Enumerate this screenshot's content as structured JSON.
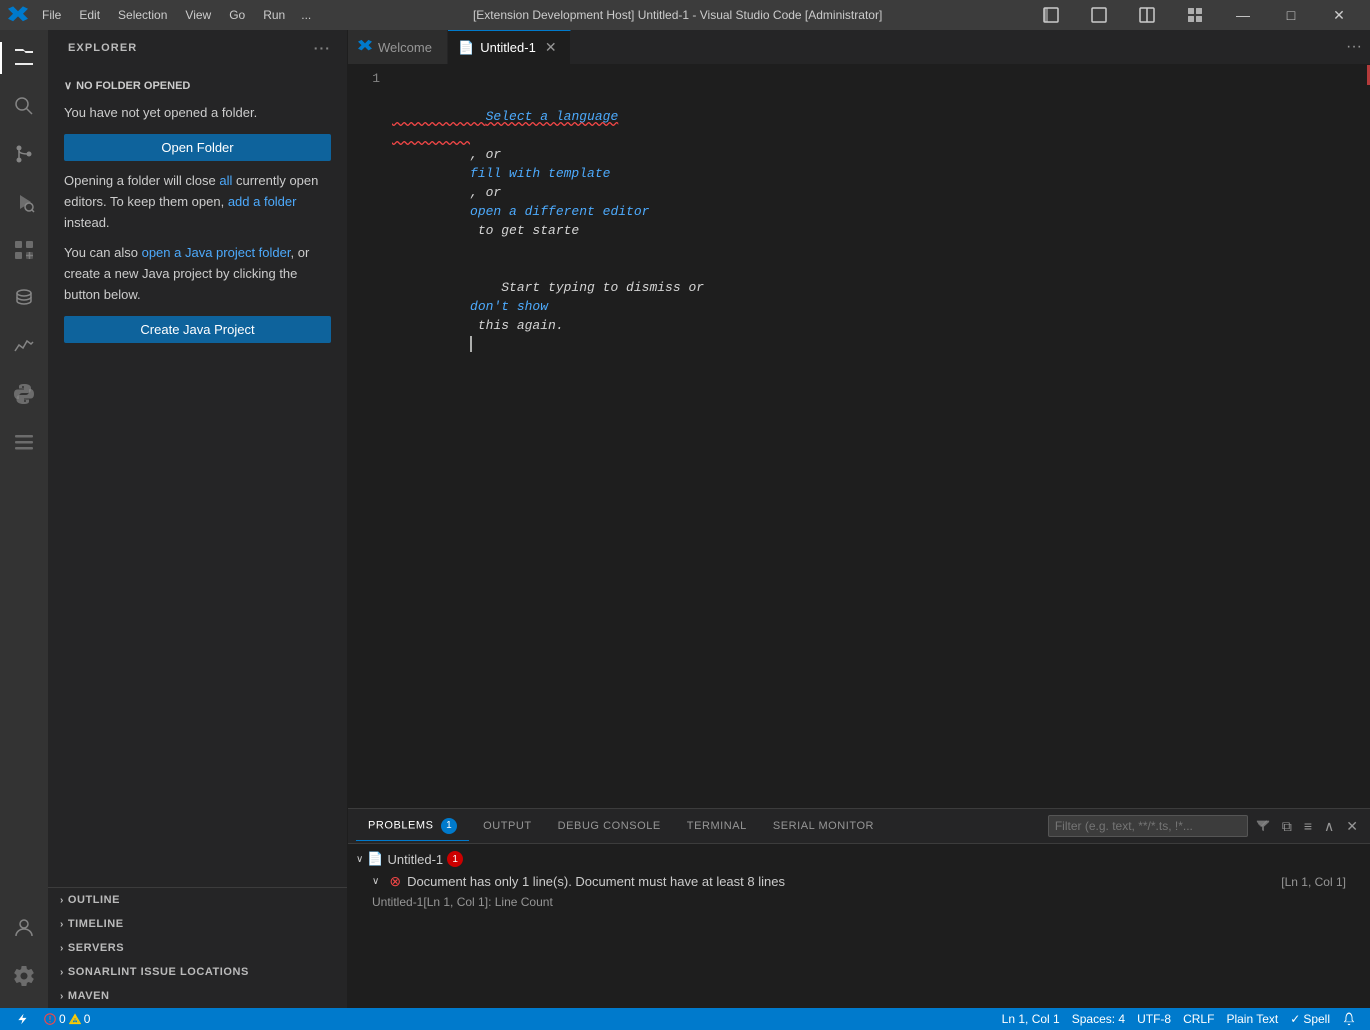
{
  "titlebar": {
    "title": "[Extension Development Host] Untitled-1 - Visual Studio Code [Administrator]",
    "menu": [
      "File",
      "Edit",
      "Selection",
      "View",
      "Go",
      "Run",
      "..."
    ],
    "controls": {
      "minimize": "—",
      "maximize": "□",
      "close": "✕"
    }
  },
  "activity_bar": {
    "items": [
      {
        "id": "explorer",
        "icon": "⎘",
        "label": "Explorer",
        "active": true
      },
      {
        "id": "search",
        "icon": "🔍",
        "label": "Search"
      },
      {
        "id": "source-control",
        "icon": "⑂",
        "label": "Source Control"
      },
      {
        "id": "run",
        "icon": "▷",
        "label": "Run and Debug"
      },
      {
        "id": "extensions",
        "icon": "⊞",
        "label": "Extensions"
      },
      {
        "id": "database",
        "icon": "⊡",
        "label": "Database"
      },
      {
        "id": "monitoring",
        "icon": "📈",
        "label": "Monitoring"
      },
      {
        "id": "python",
        "icon": "🐍",
        "label": "Python"
      },
      {
        "id": "stacks",
        "icon": "≡",
        "label": "Stacks"
      }
    ],
    "bottom": [
      {
        "id": "accounts",
        "icon": "👤",
        "label": "Accounts"
      },
      {
        "id": "settings",
        "icon": "⚙",
        "label": "Settings"
      }
    ]
  },
  "sidebar": {
    "header": "Explorer",
    "no_folder": {
      "title": "No Folder Opened",
      "text1": "You have not yet opened a folder.",
      "open_folder_btn": "Open Folder",
      "text2_prefix": "Opening a folder will close ",
      "text2_link1": "all",
      "text2_mid": " currently open editors. To keep them open, ",
      "text2_link2": "add a folder",
      "text2_suffix": " instead.",
      "text3_prefix": "You can also ",
      "text3_link1": "open a Java project folder",
      "text3_mid": ", or create a new Java project by clicking the button below.",
      "create_java_btn": "Create Java Project"
    },
    "sections": [
      {
        "id": "outline",
        "label": "OUTLINE"
      },
      {
        "id": "timeline",
        "label": "TIMELINE"
      },
      {
        "id": "servers",
        "label": "SERVERS"
      },
      {
        "id": "sonarlint",
        "label": "SONARLINT ISSUE LOCATIONS"
      },
      {
        "id": "maven",
        "label": "MAVEN"
      }
    ]
  },
  "tabs": [
    {
      "id": "welcome",
      "label": "Welcome",
      "icon": "vscode",
      "active": false
    },
    {
      "id": "untitled1",
      "label": "Untitled-1",
      "icon": "file",
      "active": true,
      "modified": true,
      "close": "✕"
    }
  ],
  "editor": {
    "line_numbers": [
      "1"
    ],
    "line1_part1": "Select a language",
    "line1_sep1": ", or ",
    "line1_part2": "fill with template",
    "line1_sep2": ", or ",
    "line1_part3": "open a different editor",
    "line1_sep3": " to get starte",
    "line2_part1": "Start typing to dismiss or ",
    "line2_link": "don't show",
    "line2_suffix": " this again."
  },
  "panel": {
    "tabs": [
      {
        "id": "problems",
        "label": "PROBLEMS",
        "badge": "1",
        "active": true
      },
      {
        "id": "output",
        "label": "OUTPUT"
      },
      {
        "id": "debug-console",
        "label": "DEBUG CONSOLE"
      },
      {
        "id": "terminal",
        "label": "TERMINAL"
      },
      {
        "id": "serial-monitor",
        "label": "SERIAL MONITOR"
      }
    ],
    "filter_placeholder": "Filter (e.g. text, **/*.ts, !*...",
    "problems": [
      {
        "filename": "Untitled-1",
        "badge": "1",
        "items": [
          {
            "message": "Document has only 1 line(s). Document must have at least 8 lines",
            "location": "[Ln 1, Col 1]",
            "source": "Untitled-1[Ln 1, Col 1]: Line Count"
          }
        ]
      }
    ]
  },
  "status_bar": {
    "errors": "0",
    "warnings": "0",
    "position": "Ln 1, Col 1",
    "spaces": "Spaces: 4",
    "encoding": "UTF-8",
    "line_ending": "CRLF",
    "language": "Plain Text",
    "spell": "Spell",
    "notifications": "🔔"
  }
}
